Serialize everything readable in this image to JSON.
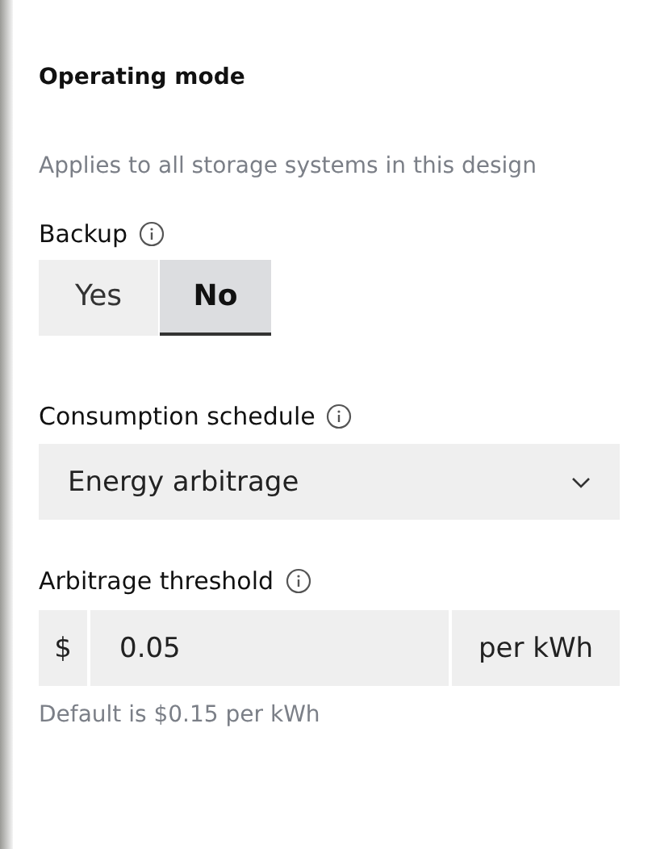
{
  "section": {
    "title": "Operating mode",
    "description": "Applies to all storage systems in this design"
  },
  "backup": {
    "label": "Backup",
    "options": [
      {
        "label": "Yes",
        "selected": false
      },
      {
        "label": "No",
        "selected": true
      }
    ]
  },
  "consumption_schedule": {
    "label": "Consumption schedule",
    "value": "Energy arbitrage"
  },
  "arbitrage_threshold": {
    "label": "Arbitrage threshold",
    "prefix": "$",
    "value": "0.05",
    "suffix": "per kWh",
    "help": "Default is $0.15 per kWh"
  }
}
